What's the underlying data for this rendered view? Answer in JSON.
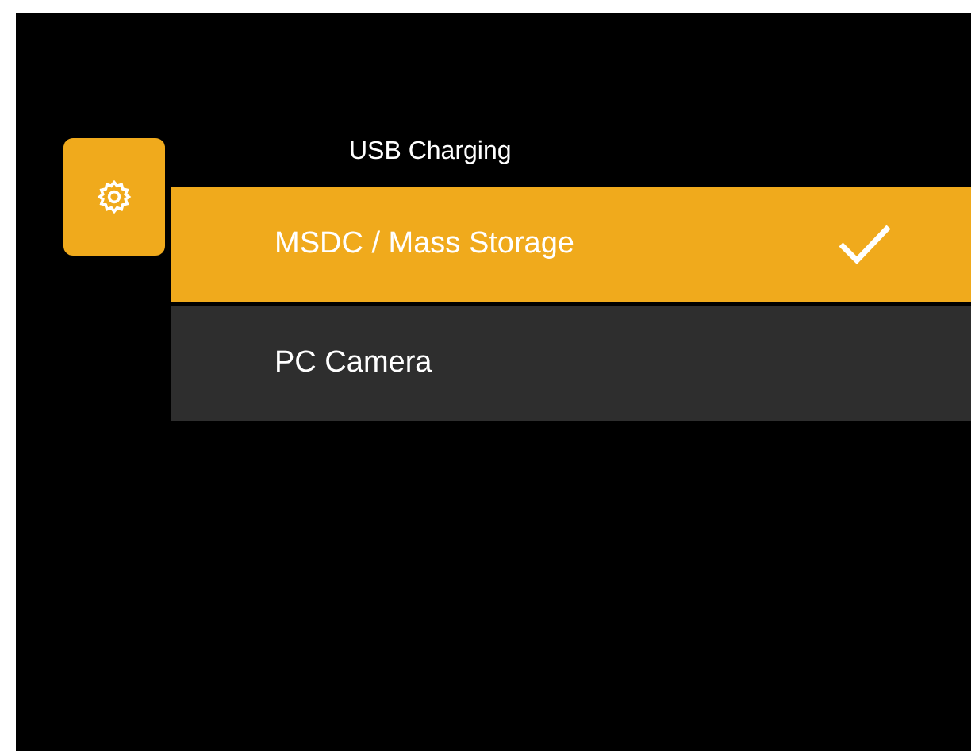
{
  "menu": {
    "title": "USB Charging",
    "options": [
      {
        "label": "MSDC / Mass Storage",
        "selected": true
      },
      {
        "label": "PC Camera",
        "selected": false
      }
    ]
  }
}
